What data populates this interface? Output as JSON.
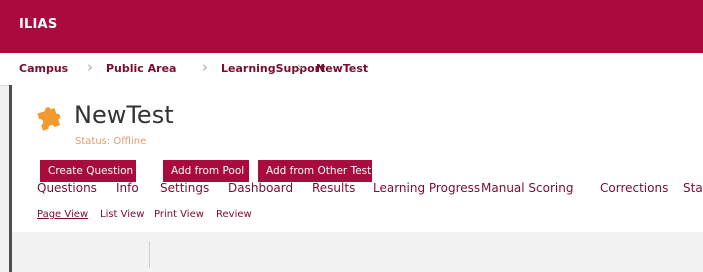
{
  "header": {
    "brand": "ILIAS"
  },
  "breadcrumbs": [
    "Campus",
    "Public Area",
    "LearningSupport",
    "NewTest"
  ],
  "object": {
    "title": "NewTest",
    "status": "Status: Offline",
    "icon": "puzzle-icon"
  },
  "tabs": [
    "Questions",
    "Info",
    "Settings",
    "Dashboard",
    "Results",
    "Learning Progress",
    "Manual Scoring",
    "Corrections",
    "Sta"
  ],
  "subtabs": [
    "Page View",
    "List View",
    "Print View",
    "Review"
  ],
  "toolbar": {
    "create_question": "Create Question",
    "add_from_pool": "Add from Pool",
    "add_from_other_test": "Add from Other Test"
  },
  "colors": {
    "accent": "#a90b3c",
    "link": "#7a0c2e",
    "icon": "#f29a2e",
    "status": "#e39c6f"
  }
}
